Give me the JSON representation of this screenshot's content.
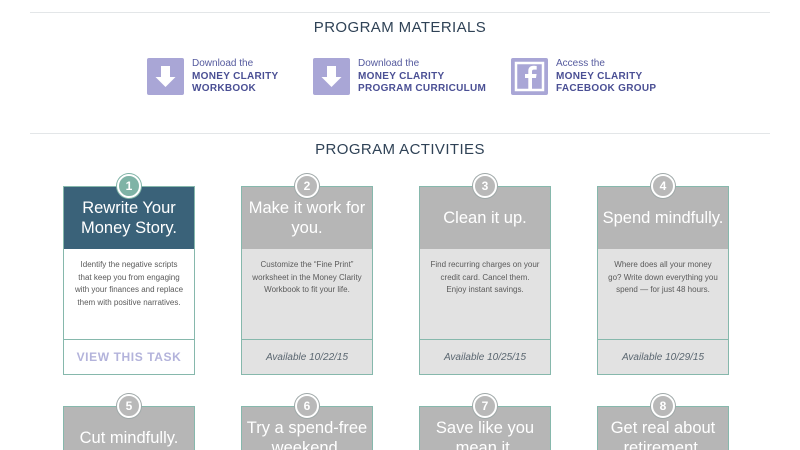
{
  "materials": {
    "title": "PROGRAM MATERIALS",
    "items": [
      {
        "pre": "Download the",
        "line1": "MONEY CLARITY",
        "line2": "WORKBOOK",
        "icon": "download-icon"
      },
      {
        "pre": "Download the",
        "line1": "MONEY CLARITY",
        "line2": "PROGRAM CURRICULUM",
        "icon": "download-icon"
      },
      {
        "pre": "Access the",
        "line1": "MONEY CLARITY",
        "line2": "FACEBOOK GROUP",
        "icon": "facebook-icon"
      }
    ]
  },
  "activities": {
    "title": "PROGRAM ACTIVITIES",
    "cards": [
      {
        "num": "1",
        "title": "Rewrite Your Money Story.",
        "desc": "Identify the negative scripts that keep you from engaging with your finances and replace them with positive narratives.",
        "footer": "VIEW THIS TASK",
        "active": true
      },
      {
        "num": "2",
        "title": "Make it work for you.",
        "desc": "Customize the “Fine Print” worksheet in the Money Clarity Workbook to fit your life.",
        "footer": "Available 10/22/15"
      },
      {
        "num": "3",
        "title": "Clean it up.",
        "desc": "Find recurring charges on your credit card. Cancel them. Enjoy instant savings.",
        "footer": "Available 10/25/15"
      },
      {
        "num": "4",
        "title": "Spend mindfully.",
        "desc": "Where does all your money go? Write down everything you spend — for just 48 hours.",
        "footer": "Available 10/29/15"
      },
      {
        "num": "5",
        "title": "Cut mindfully.",
        "desc": "",
        "footer": ""
      },
      {
        "num": "6",
        "title": "Try a spend-free weekend.",
        "desc": "",
        "footer": ""
      },
      {
        "num": "7",
        "title": "Save like you mean it.",
        "desc": "",
        "footer": ""
      },
      {
        "num": "8",
        "title": "Get real about retirement.",
        "desc": "",
        "footer": ""
      }
    ]
  },
  "colors": {
    "active_header": "#3a6279",
    "locked_header": "#b6b6b6",
    "accent_purple": "#a9a6d6",
    "badge_active": "#7fb3a6"
  }
}
